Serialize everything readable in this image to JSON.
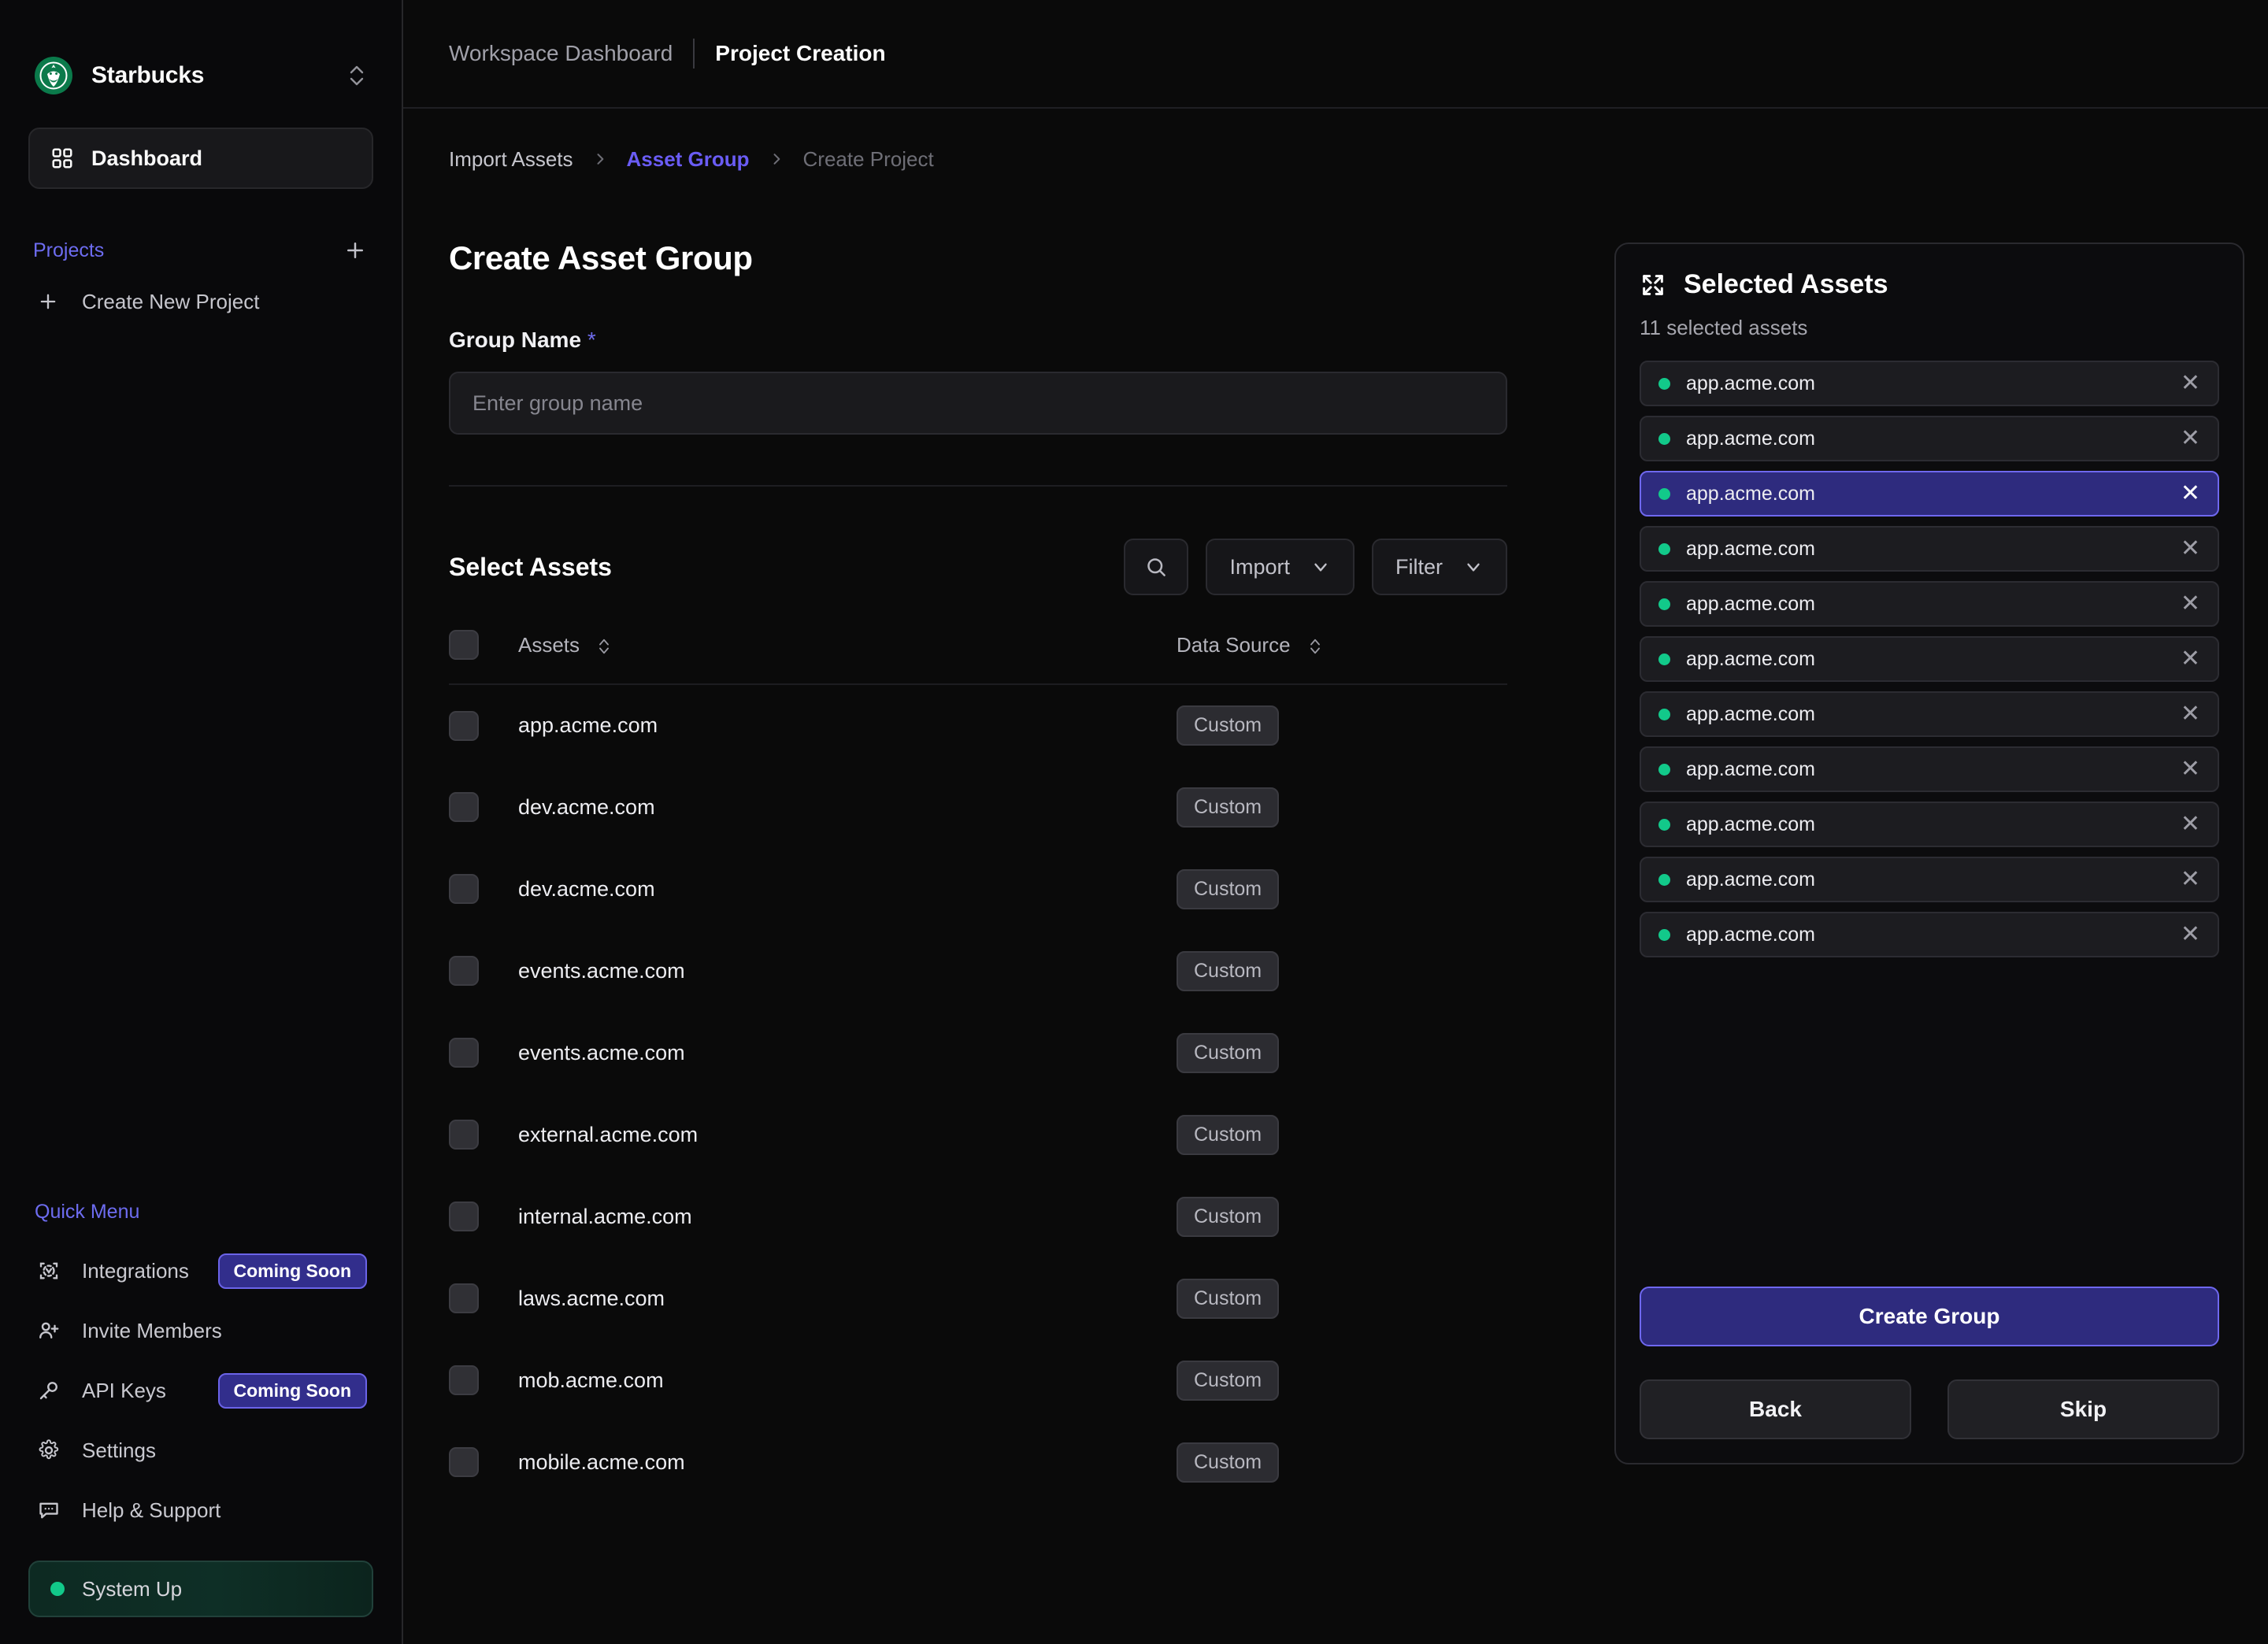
{
  "sidebar": {
    "org": {
      "name": "Starbucks",
      "switcher_icon": "chevron-up-down-icon",
      "logo_icon": "starbucks-logo"
    },
    "nav": {
      "dashboard_label": "Dashboard",
      "dashboard_icon": "grid-icon"
    },
    "projects": {
      "title": "Projects",
      "add_icon": "plus-icon",
      "create_label": "Create New Project",
      "create_icon": "plus-icon"
    },
    "quick_menu": {
      "title": "Quick Menu",
      "items": [
        {
          "label": "Integrations",
          "icon": "integrations-icon",
          "badge": "Coming Soon"
        },
        {
          "label": "Invite Members",
          "icon": "user-plus-icon",
          "badge": ""
        },
        {
          "label": "API Keys",
          "icon": "key-icon",
          "badge": "Coming Soon"
        },
        {
          "label": "Settings",
          "icon": "gear-icon",
          "badge": ""
        },
        {
          "label": "Help & Support",
          "icon": "chat-bubble-icon",
          "badge": ""
        }
      ]
    },
    "status": {
      "label": "System Up",
      "dot_color": "#12c98a"
    }
  },
  "topbar": {
    "workspace": "Workspace Dashboard",
    "section": "Project Creation"
  },
  "breadcrumb": {
    "items": [
      "Import Assets",
      "Asset Group",
      "Create Project"
    ],
    "active_index": 1
  },
  "form": {
    "title": "Create Asset Group",
    "group_name_label": "Group Name",
    "required_mark": "*",
    "group_name_value": "",
    "group_name_placeholder": "Enter group name"
  },
  "assets_section": {
    "title": "Select Assets",
    "search_icon": "search-icon",
    "import_label": "Import",
    "filter_label": "Filter",
    "chevron_icon": "chevron-down-icon",
    "columns": [
      "Assets",
      "Data Source"
    ],
    "rows": [
      {
        "name": "app.acme.com",
        "source": "Custom",
        "checked": false
      },
      {
        "name": "dev.acme.com",
        "source": "Custom",
        "checked": false
      },
      {
        "name": "dev.acme.com",
        "source": "Custom",
        "checked": false
      },
      {
        "name": "events.acme.com",
        "source": "Custom",
        "checked": false
      },
      {
        "name": "events.acme.com",
        "source": "Custom",
        "checked": false
      },
      {
        "name": "external.acme.com",
        "source": "Custom",
        "checked": false
      },
      {
        "name": "internal.acme.com",
        "source": "Custom",
        "checked": false
      },
      {
        "name": "laws.acme.com",
        "source": "Custom",
        "checked": false
      },
      {
        "name": "mob.acme.com",
        "source": "Custom",
        "checked": false
      },
      {
        "name": "mobile.acme.com",
        "source": "Custom",
        "checked": false
      }
    ]
  },
  "selected_panel": {
    "title": "Selected Assets",
    "expand_icon": "expand-icon",
    "count_text": "11 selected assets",
    "remove_icon": "close-icon",
    "chips": [
      {
        "name": "app.acme.com",
        "selected": false
      },
      {
        "name": "app.acme.com",
        "selected": false
      },
      {
        "name": "app.acme.com",
        "selected": true
      },
      {
        "name": "app.acme.com",
        "selected": false
      },
      {
        "name": "app.acme.com",
        "selected": false
      },
      {
        "name": "app.acme.com",
        "selected": false
      },
      {
        "name": "app.acme.com",
        "selected": false
      },
      {
        "name": "app.acme.com",
        "selected": false
      },
      {
        "name": "app.acme.com",
        "selected": false
      },
      {
        "name": "app.acme.com",
        "selected": false
      },
      {
        "name": "app.acme.com",
        "selected": false
      }
    ],
    "create_label": "Create Group",
    "back_label": "Back",
    "skip_label": "Skip"
  },
  "colors": {
    "accent": "#6a5cf5",
    "accent_bg": "#2e2b7e",
    "success": "#12c98a",
    "page_bg": "#0a0a0a"
  }
}
